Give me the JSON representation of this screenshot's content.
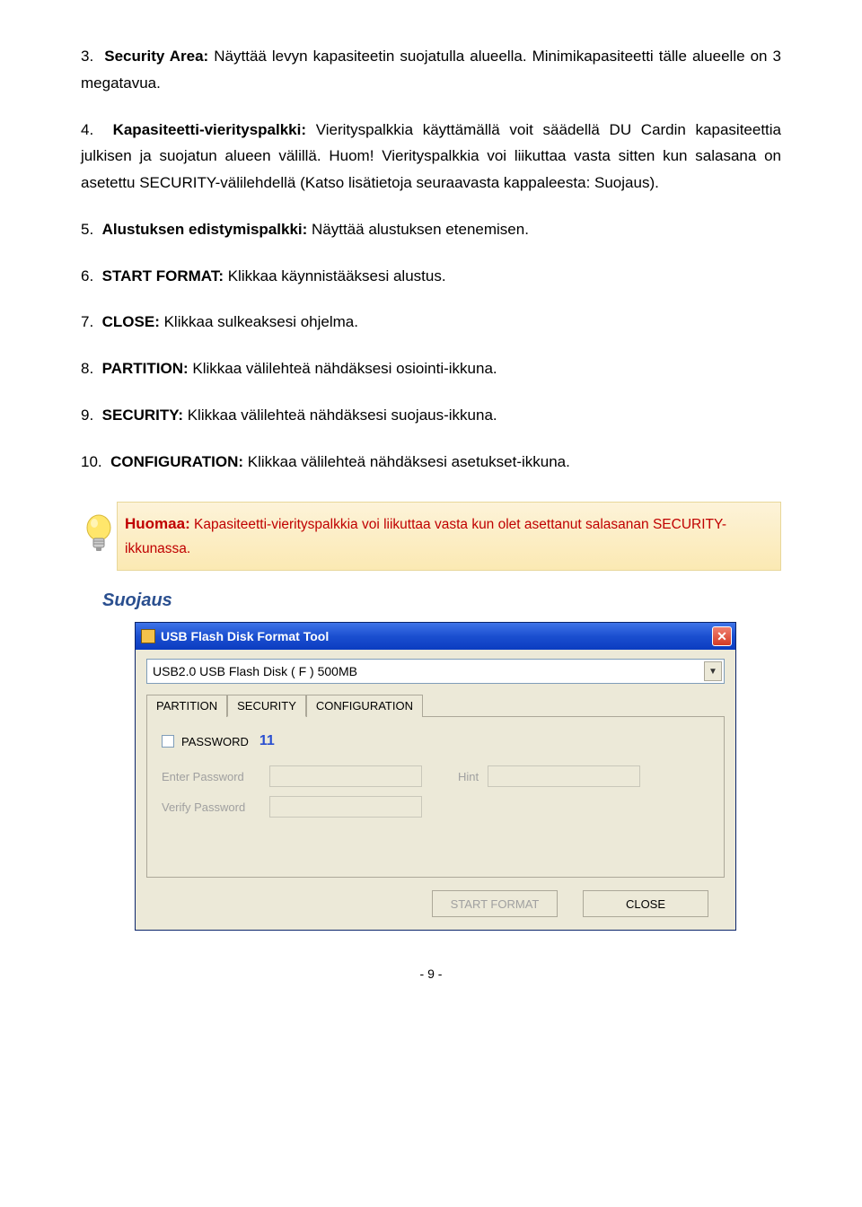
{
  "items": [
    {
      "num": "3.",
      "bold": "Security Area:",
      "rest": " Näyttää levyn kapasiteetin suojatulla alueella. Minimikapasiteetti tälle alueelle on 3 megatavua."
    },
    {
      "num": "4.",
      "bold": "Kapasiteetti-vierityspalkki:",
      "rest": " Vierityspalkkia käyttämällä voit säädellä DU Cardin kapasiteettia julkisen ja suojatun alueen välillä. Huom! Vierityspalkkia voi liikuttaa vasta sitten kun salasana on asetettu SECURITY-välilehdellä (Katso lisätietoja seuraavasta kappaleesta: Suojaus)."
    },
    {
      "num": "5.",
      "bold": "Alustuksen edistymispalkki:",
      "rest": " Näyttää alustuksen etenemisen."
    },
    {
      "num": "6.",
      "bold": "START FORMAT:",
      "rest": " Klikkaa käynnistääksesi alustus."
    },
    {
      "num": "7.",
      "bold": "CLOSE:",
      "rest": " Klikkaa sulkeaksesi ohjelma."
    },
    {
      "num": "8.",
      "bold": "PARTITION:",
      "rest": " Klikkaa välilehteä nähdäksesi osiointi-ikkuna."
    },
    {
      "num": "9.",
      "bold": "SECURITY:",
      "rest": " Klikkaa välilehteä nähdäksesi suojaus-ikkuna."
    },
    {
      "num": "10.",
      "bold": "CONFIGURATION:",
      "rest": " Klikkaa välilehteä nähdäksesi asetukset-ikkuna."
    }
  ],
  "note": {
    "lead": "Huomaa:",
    "body": " Kapasiteetti-vierityspalkkia voi liikuttaa vasta kun olet asettanut salasanan SECURITY-ikkunassa."
  },
  "section_heading": "Suojaus",
  "window": {
    "title": "USB Flash Disk Format Tool",
    "combo_value": "USB2.0   USB Flash Disk  ( F )        500MB",
    "tabs": {
      "partition": "PARTITION",
      "security": "SECURITY",
      "configuration": "CONFIGURATION"
    },
    "password_label": "PASSWORD",
    "badge": "11",
    "enter_password": "Enter Password",
    "verify_password": "Verify Password",
    "hint": "Hint",
    "start_format": "START FORMAT",
    "close": "CLOSE"
  },
  "page_number": "- 9 -"
}
